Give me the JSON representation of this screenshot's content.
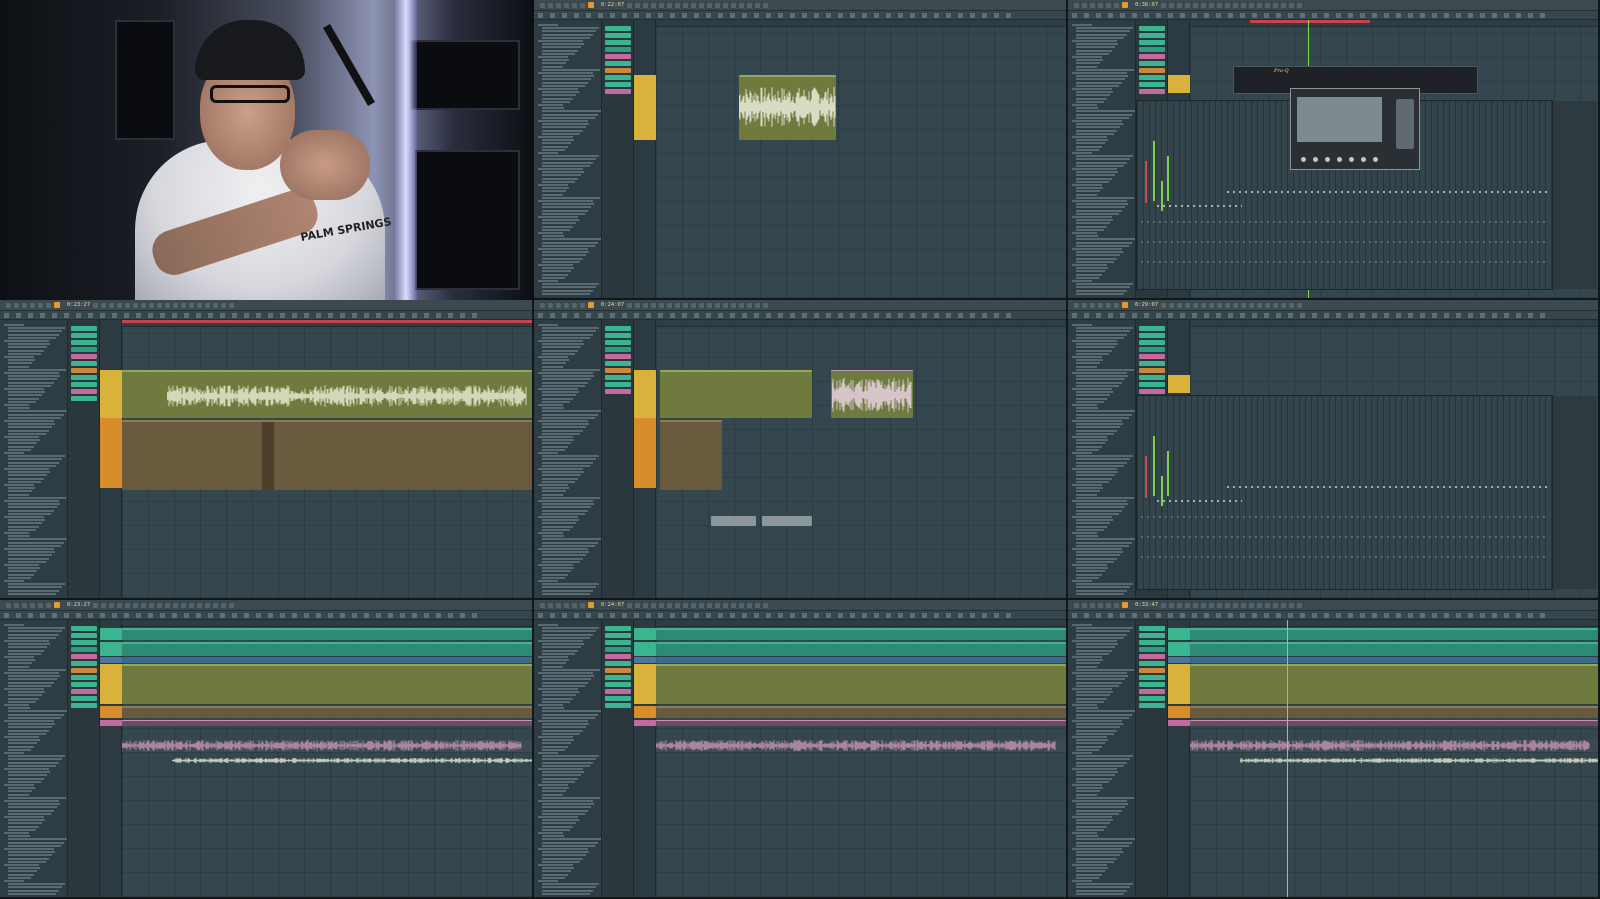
{
  "layout": "3x3 grid of Fl Studio screen captures with presenter webcam in top-left",
  "webcam": {
    "shirt_text": "PALM SPRINGS"
  },
  "panels": [
    {
      "id": "p2",
      "time": "0:22:07",
      "view": "playlist-single-clip"
    },
    {
      "id": "p3",
      "time": "0:36:07",
      "view": "mixer-with-plugin",
      "plugin_label": "Pro-Q"
    },
    {
      "id": "p4",
      "time": "0:23:27",
      "view": "playlist-vocal-automation"
    },
    {
      "id": "p5",
      "time": "0:24:07",
      "view": "playlist-vocal-chop"
    },
    {
      "id": "p6",
      "time": "0:29:07",
      "view": "mixer"
    },
    {
      "id": "p7",
      "time": "0:23:27",
      "view": "playlist-arrangement"
    },
    {
      "id": "p8",
      "time": "0:24:07",
      "view": "playlist-arrangement"
    },
    {
      "id": "p9",
      "time": "0:33:47",
      "view": "playlist-arrangement"
    }
  ],
  "colors": {
    "olive": "#6f7a3e",
    "brown": "#6a5a3d",
    "teal": "#2d8a73",
    "pink": "#c594b4",
    "yellow_swatch": "#d8b23a",
    "orange_swatch": "#d78d2c",
    "playhead": "#7ddc47",
    "marker": "#c8434c"
  }
}
